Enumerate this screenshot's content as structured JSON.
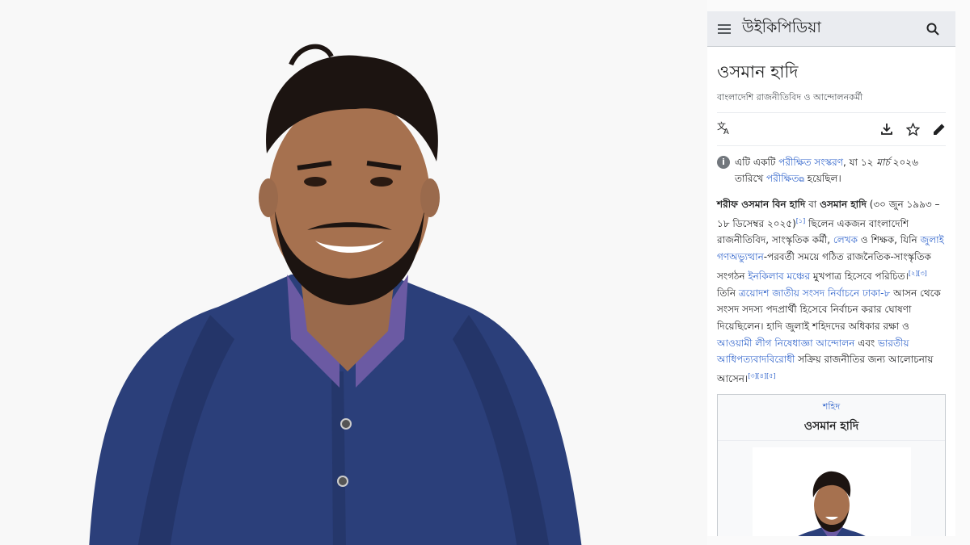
{
  "header": {
    "wordmark": "উইকিপিডিয়া",
    "menu_icon": "hamburger-menu-icon",
    "search_icon": "search-icon"
  },
  "article": {
    "title": "ওসমান হাদি",
    "description": "বাংলাদেশি রাজনীতিবিদ ও আন্দোলনকর্মী"
  },
  "actions": {
    "language_icon": "language-icon",
    "download_icon": "download-icon",
    "watch_icon": "star-icon",
    "edit_icon": "pencil-icon"
  },
  "flagged": {
    "t1": "এটি একটি ",
    "link1": "পরীক্ষিত সংস্করণ",
    "t2": ", যা ১২ ",
    "month": "মার্চ",
    "t3": " ২০২৬",
    "t4": "তারিখে ",
    "link2": "পরীক্ষিত",
    "t5": " হয়েছিল।"
  },
  "intro": {
    "name_full": "শরীফ ওসমান বিন হাদি",
    "t1": " বা ",
    "name_short": "ওসমান হাদি",
    "t2": " (৩০ জুন ১৯৯৩ – ১৮ ডিসেম্বর ২০২৫)",
    "ref1": "[১]",
    "t3": " ছিলেন একজন বাংলাদেশি রাজনীতিবিদ, সাংস্কৃতিক কর্মী, ",
    "link_writer": "লেখক",
    "t4": " ও শিক্ষক, যিনি ",
    "link_july": "জুলাই গণঅভ্যুত্থান",
    "t5": "-পরবর্তী সময়ে গঠিত রাজনৈতিক-সাংস্কৃতিক সংগঠন ",
    "link_inqilab": "ইনকিলাব মঞ্চের",
    "t6": " মুখপাত্র হিসেবে পরিচিত।",
    "ref2": "[২][৩]",
    "t7": " তিনি ",
    "link_election": "ত্রয়োদশ জাতীয় সংসদ নির্বাচনে",
    "t8": " ",
    "link_dhaka": "ঢাকা-৮",
    "t9": " আসন থেকে সংসদ সদস্য পদপ্রার্থী হিসেবে নির্বাচন করার ঘোষণা দিয়েছিলেন। হাদি জুলাই শহিদদের অধিকার রক্ষা ও ",
    "link_ban": "আওয়ামী লীগ নিষেধাজ্ঞা আন্দোলন",
    "t10": " এবং ",
    "link_anti": "ভারতীয় আধিপত্যবাদবিরোধী",
    "t11": " সক্রিয় রাজনীতির জন্য আলোচনায় আসেন।",
    "ref3": "[৩][৪][৫]"
  },
  "infobox": {
    "above": "শহিদ",
    "name": "ওসমান হাদি"
  },
  "colors": {
    "link": "#3366cc",
    "header_bg": "#eaecf0",
    "shirt": "#2b3f7a",
    "collar": "#6b5aa3"
  }
}
